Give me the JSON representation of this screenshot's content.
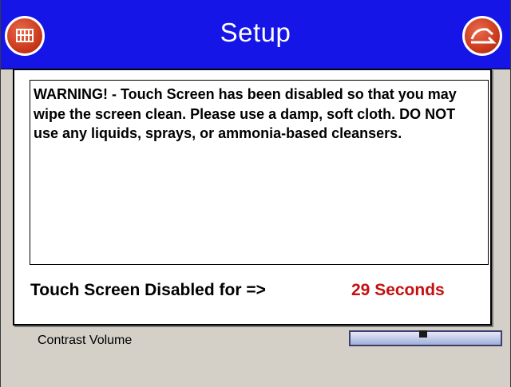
{
  "window": {
    "title": "Setup"
  },
  "header": {
    "left_button_icon": "menu-grid-icon",
    "right_button_icon": "exit-icon",
    "accent_color": "#1515e8",
    "button_color": "#cc3a1c"
  },
  "background": {
    "setting_label": "Contrast Volume"
  },
  "dialog": {
    "message": "WARNING! - Touch Screen has been disabled so that you may wipe the screen clean. Please use a damp, soft cloth. DO NOT use any liquids, sprays, or ammonia-based cleansers.",
    "countdown_label": "Touch Screen Disabled for =>",
    "countdown_value": "29 Seconds",
    "countdown_color": "#c41010"
  }
}
